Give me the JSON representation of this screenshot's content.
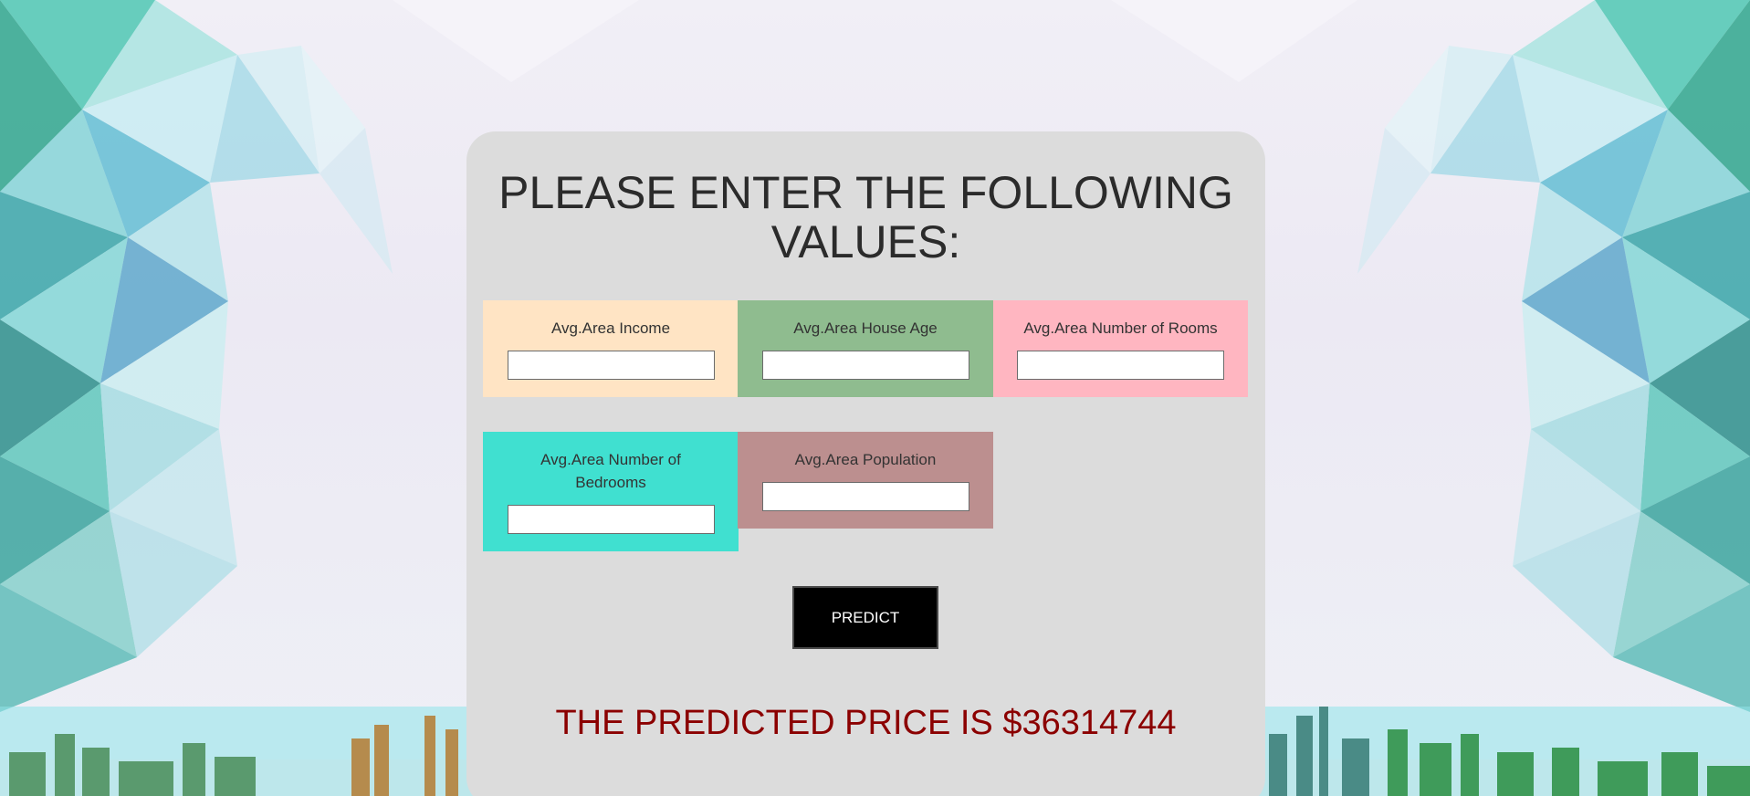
{
  "form": {
    "heading": "PLEASE ENTER THE FOLLOWING VALUES:",
    "fields": [
      {
        "label": "Avg.Area Income",
        "value": "",
        "color": "#ffe4c4"
      },
      {
        "label": "Avg.Area House Age",
        "value": "",
        "color": "#8fbc8f"
      },
      {
        "label": "Avg.Area Number of Rooms",
        "value": "",
        "color": "#ffb6c1"
      },
      {
        "label": "Avg.Area Number of Bedrooms",
        "value": "",
        "color": "#40e0d0"
      },
      {
        "label": "Avg.Area Population",
        "value": "",
        "color": "#bc8f8f"
      }
    ],
    "predict_label": "PREDICT"
  },
  "result": {
    "text": "THE PREDICTED PRICE IS $36314744",
    "color": "#8b0000"
  },
  "colors": {
    "card_background": "#dcdcdc",
    "button_background": "#000000",
    "background_accent": "#4fd6c8"
  }
}
